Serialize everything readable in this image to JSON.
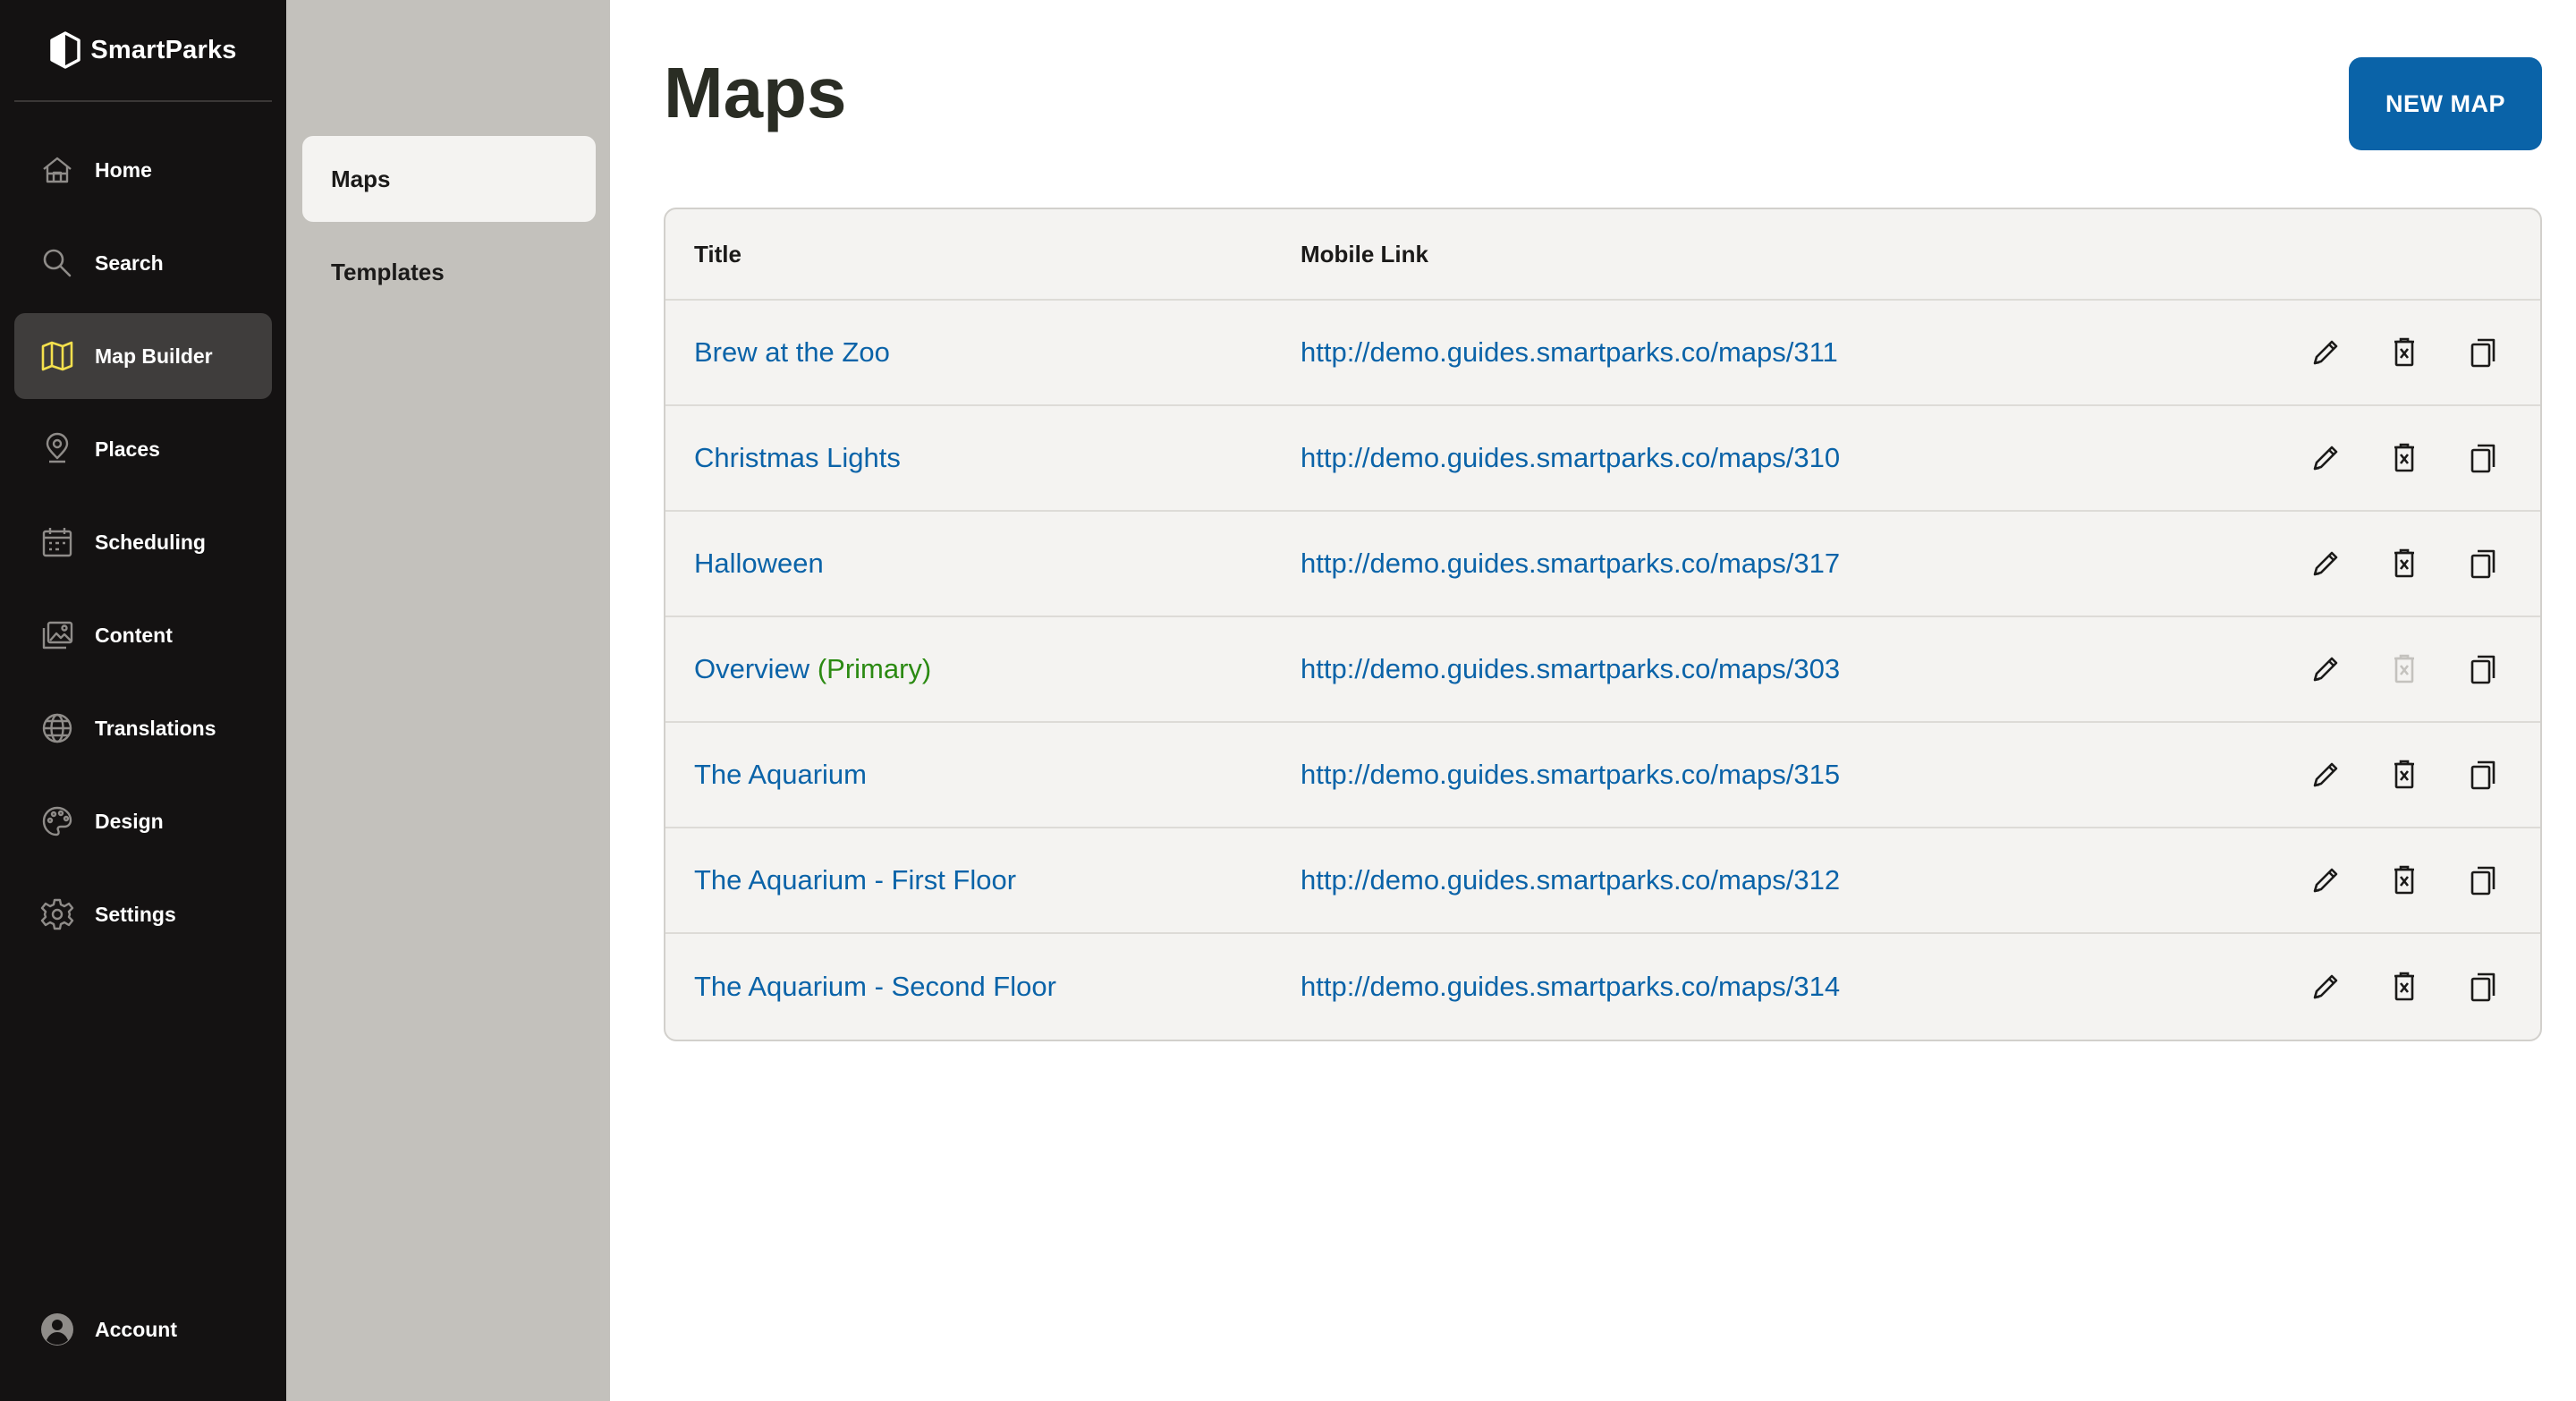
{
  "brand": {
    "name": "SmartParks"
  },
  "sidebar": {
    "items": [
      {
        "label": "Home",
        "icon": "home-icon"
      },
      {
        "label": "Search",
        "icon": "search-icon"
      },
      {
        "label": "Map Builder",
        "icon": "map-icon",
        "active": true
      },
      {
        "label": "Places",
        "icon": "map-pin-icon"
      },
      {
        "label": "Scheduling",
        "icon": "calendar-icon"
      },
      {
        "label": "Content",
        "icon": "images-icon"
      },
      {
        "label": "Translations",
        "icon": "globe-icon"
      },
      {
        "label": "Design",
        "icon": "palette-icon"
      },
      {
        "label": "Settings",
        "icon": "gear-icon"
      }
    ],
    "account_label": "Account"
  },
  "subnav": {
    "items": [
      {
        "label": "Maps",
        "active": true
      },
      {
        "label": "Templates"
      }
    ]
  },
  "page": {
    "title": "Maps",
    "new_button": "NEW MAP"
  },
  "table": {
    "headers": {
      "title": "Title",
      "mobile_link": "Mobile Link"
    },
    "rows": [
      {
        "title": "Brew at the Zoo",
        "tag": "",
        "link": "http://demo.guides.smartparks.co/maps/311",
        "delete_enabled": true
      },
      {
        "title": "Christmas Lights",
        "tag": "",
        "link": "http://demo.guides.smartparks.co/maps/310",
        "delete_enabled": true
      },
      {
        "title": "Halloween",
        "tag": "",
        "link": "http://demo.guides.smartparks.co/maps/317",
        "delete_enabled": true
      },
      {
        "title": "Overview",
        "tag": "(Primary)",
        "link": "http://demo.guides.smartparks.co/maps/303",
        "delete_enabled": false
      },
      {
        "title": "The Aquarium",
        "tag": "",
        "link": "http://demo.guides.smartparks.co/maps/315",
        "delete_enabled": true
      },
      {
        "title": "The Aquarium - First Floor",
        "tag": "",
        "link": "http://demo.guides.smartparks.co/maps/312",
        "delete_enabled": true
      },
      {
        "title": "The Aquarium - Second Floor",
        "tag": "",
        "link": "http://demo.guides.smartparks.co/maps/314",
        "delete_enabled": true
      }
    ]
  },
  "colors": {
    "sidebar_bg": "#141212",
    "subnav_bg": "#c3c1bc",
    "accent": "#0a63a8",
    "primary_tag": "#2b8a12",
    "title_text": "#2a2d24"
  }
}
